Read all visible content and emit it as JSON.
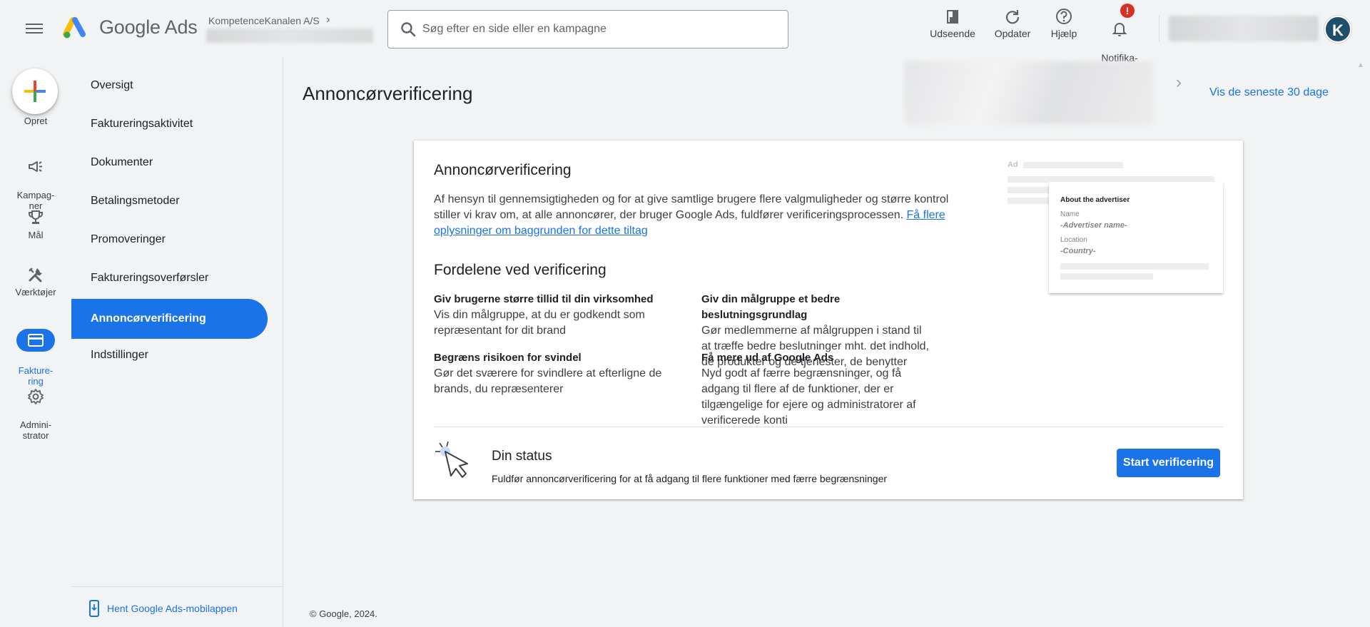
{
  "header": {
    "logo_text": "Google Ads",
    "account_name": "KompetenceKanalen A/S",
    "search_placeholder": "Søg efter en side eller en kampagne",
    "buttons": [
      {
        "label": "Udseende",
        "icon": "appearance-icon"
      },
      {
        "label": "Opdater",
        "icon": "refresh-icon"
      },
      {
        "label": "Hjælp",
        "icon": "help-icon"
      },
      {
        "label": "Notifika-\ntioner",
        "icon": "bell-icon"
      }
    ],
    "notification_badge": "!",
    "avatar_initial": "K"
  },
  "rail": {
    "create_label": "Opret",
    "items": [
      {
        "label": "Kampag-\nner",
        "icon": "campaign-icon"
      },
      {
        "label": "Mål",
        "icon": "trophy-icon"
      },
      {
        "label": "Værktøjer",
        "icon": "tools-icon"
      },
      {
        "label": "Fakture-\nring",
        "icon": "billing-card-icon"
      },
      {
        "label": "Admini-\nstrator",
        "icon": "gear-icon"
      }
    ]
  },
  "subnav": {
    "items": [
      {
        "label": "Oversigt"
      },
      {
        "label": "Faktureringsaktivitet"
      },
      {
        "label": "Dokumenter"
      },
      {
        "label": "Betalingsmetoder"
      },
      {
        "label": "Promoveringer"
      },
      {
        "label": "Faktureringsoverførsler"
      },
      {
        "label": "Annoncørverificering"
      },
      {
        "label": "Indstillinger"
      }
    ],
    "active_index": 6,
    "app_link": "Hent Google Ads-mobilappen"
  },
  "page": {
    "title": "Annoncørverificering",
    "date_range": "Vis de seneste 30 dage"
  },
  "card": {
    "title": "Annoncørverificering",
    "description": "Af hensyn til gennemsigtigheden og for at give samtlige brugere flere valgmuligheder og større kontrol stiller vi krav om, at alle annoncører, der bruger Google Ads, fuldfører verificeringsprocessen. ",
    "learn_more": "Få flere oplysninger om baggrunden for dette tiltag",
    "benefits_title": "Fordelene ved verificering",
    "benefits": [
      {
        "title": "Giv brugerne større tillid til din virksomhed",
        "desc": "Vis din målgruppe, at du er godkendt som repræsentant for dit brand"
      },
      {
        "title": "Giv din målgruppe et bedre beslutningsgrundlag",
        "desc": "Gør medlemmerne af målgruppen i stand til at træffe bedre beslutninger mht. det indhold, de produkter og de tjenester, de benytter"
      },
      {
        "title": "Begræns risikoen for svindel",
        "desc": "Gør det sværere for svindlere at efterligne de brands, du repræsenterer"
      },
      {
        "title": "Få mere ud af Google Ads",
        "desc": "Nyd godt af færre begrænsninger, og få adgang til flere af de funktioner, der er tilgængelige for ejere og administratorer af verificerede konti"
      }
    ],
    "preview": {
      "ad": "Ad",
      "heading": "About the advertiser",
      "name_label": "Name",
      "name_value": "-Advertiser name-",
      "location_label": "Location",
      "location_value": "-Country-"
    },
    "status": {
      "title": "Din status",
      "desc": "Fuldfør annoncørverificering for at få adgang til flere funktioner med færre begrænsninger",
      "button": "Start verificering"
    }
  },
  "footer": "© Google, 2024.",
  "colors": {
    "primary": "#1a73e8",
    "background": "#f1f3f4",
    "badge": "#d93025"
  }
}
